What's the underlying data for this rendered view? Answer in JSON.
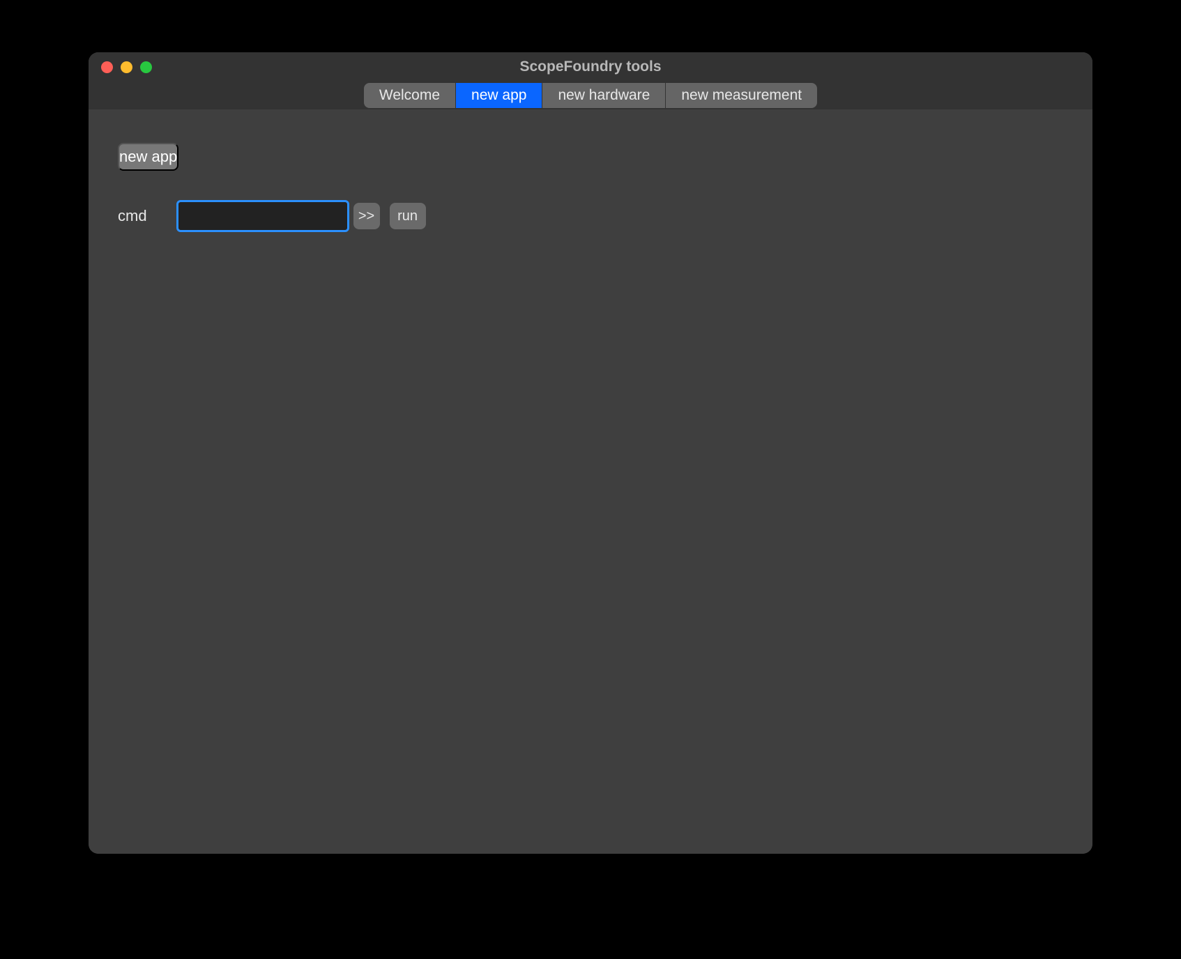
{
  "window": {
    "title": "ScopeFoundry tools"
  },
  "tabs": [
    {
      "label": "Welcome",
      "active": false
    },
    {
      "label": "new app",
      "active": true
    },
    {
      "label": "new hardware",
      "active": false
    },
    {
      "label": "new measurement",
      "active": false
    }
  ],
  "header_button": {
    "label": "new app"
  },
  "cmd": {
    "label": "cmd",
    "value": "",
    "expand_label": ">>",
    "run_label": "run"
  }
}
